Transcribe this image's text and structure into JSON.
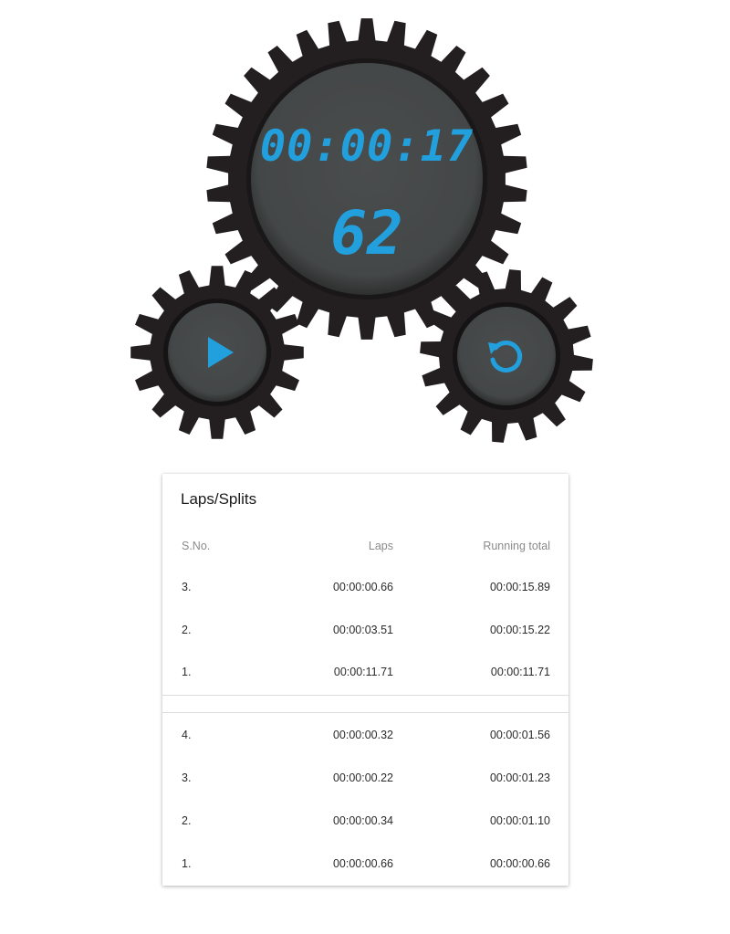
{
  "stopwatch": {
    "time": "00:00:17",
    "centiseconds": "62",
    "play_icon": "play-icon",
    "reset_icon": "reset-icon"
  },
  "laps": {
    "title": "Laps/Splits",
    "headers": {
      "sno": "S.No.",
      "lap": "Laps",
      "total": "Running total"
    },
    "set1": [
      {
        "sno": "3.",
        "lap": "00:00:00.66",
        "total": "00:00:15.89"
      },
      {
        "sno": "2.",
        "lap": "00:00:03.51",
        "total": "00:00:15.22"
      },
      {
        "sno": "1.",
        "lap": "00:00:11.71",
        "total": "00:00:11.71"
      }
    ],
    "set2": [
      {
        "sno": "4.",
        "lap": "00:00:00.32",
        "total": "00:00:01.56"
      },
      {
        "sno": "3.",
        "lap": "00:00:00.22",
        "total": "00:00:01.23"
      },
      {
        "sno": "2.",
        "lap": "00:00:00.34",
        "total": "00:00:01.10"
      },
      {
        "sno": "1.",
        "lap": "00:00:00.66",
        "total": "00:00:00.66"
      }
    ]
  },
  "colors": {
    "gear": "#231f20",
    "face": "#474a4a",
    "accent": "#22a0de"
  }
}
